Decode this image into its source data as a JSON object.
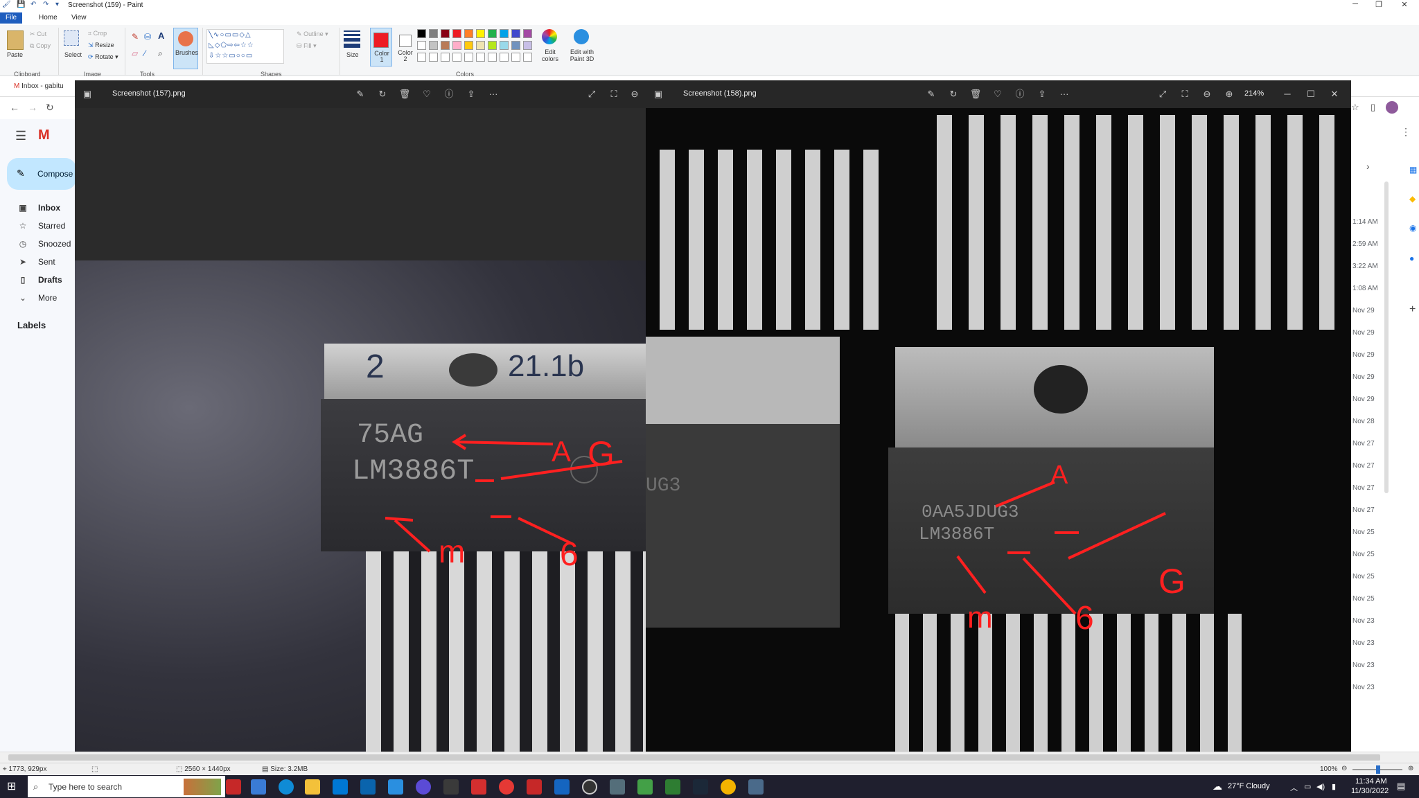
{
  "app": {
    "title": "Screenshot (159) - Paint"
  },
  "menu": {
    "tabs": [
      "File",
      "Home",
      "View"
    ]
  },
  "ribbon": {
    "clipboard": {
      "paste": "Paste",
      "cut": "Cut",
      "copy": "Copy",
      "group": "Clipboard"
    },
    "image": {
      "select": "Select",
      "crop": "Crop",
      "resize": "Resize",
      "rotate": "Rotate",
      "group": "Image"
    },
    "tools": {
      "text_icon": "A",
      "group": "Tools"
    },
    "brushes": "Brushes",
    "shapes": {
      "outline": "Outline",
      "fill": "Fill",
      "group": "Shapes"
    },
    "size": "Size",
    "color1": "Color 1",
    "color2": "Color 2",
    "colors_group": "Colors",
    "edit_colors": "Edit colors",
    "edit_paint3d": "Edit with Paint 3D",
    "palette_row1": [
      "#000000",
      "#7f7f7f",
      "#880015",
      "#ed1c24",
      "#ff7f27",
      "#fff200",
      "#22b14c",
      "#00a2e8",
      "#3f48cc",
      "#a349a4"
    ],
    "palette_row2": [
      "#ffffff",
      "#c3c3c3",
      "#b97a57",
      "#ffaec9",
      "#ffc90e",
      "#efe4b0",
      "#b5e61d",
      "#99d9ea",
      "#7092be",
      "#c8bfe7"
    ]
  },
  "gmail": {
    "tab": "Inbox - gabitu",
    "compose": "Compose",
    "items": [
      {
        "icon": "inbox-icon",
        "glyph": "▣",
        "label": "Inbox"
      },
      {
        "icon": "star-icon",
        "glyph": "☆",
        "label": "Starred"
      },
      {
        "icon": "clock-icon",
        "glyph": "◷",
        "label": "Snoozed"
      },
      {
        "icon": "send-icon",
        "glyph": "➤",
        "label": "Sent"
      },
      {
        "icon": "draft-icon",
        "glyph": "▯",
        "label": "Drafts"
      },
      {
        "icon": "chevron-down-icon",
        "glyph": "⌄",
        "label": "More"
      }
    ],
    "labels": "Labels",
    "dates": [
      "1:14 AM",
      "2:59 AM",
      "3:22 AM",
      "1:08 AM",
      "Nov 29",
      "Nov 29",
      "Nov 29",
      "Nov 29",
      "Nov 29",
      "Nov 28",
      "Nov 27",
      "Nov 27",
      "Nov 27",
      "Nov 27",
      "Nov 25",
      "Nov 25",
      "Nov 25",
      "Nov 25",
      "Nov 23",
      "Nov 23",
      "Nov 23",
      "Nov 23"
    ]
  },
  "viewer_left": {
    "filename": "Screenshot (157).png",
    "chip_text1": "75AG",
    "chip_text2": "LM3886T",
    "chip_num1": "2",
    "chip_num2": "21.1b",
    "ann_a": "A",
    "ann_g": "G",
    "ann_m": "m",
    "ann_6": "6"
  },
  "viewer_right": {
    "filename": "Screenshot (158).png",
    "zoom": "214%",
    "chip_text1": "0AA5JDUG3",
    "chip_text2": "LM3886T",
    "chip_side": "UG3",
    "ann_a": "A",
    "ann_g": "G",
    "ann_m": "m",
    "ann_6": "6"
  },
  "status": {
    "cursor": "1773, 929px",
    "dimensions": "2560 × 1440px",
    "size": "Size: 3.2MB",
    "zoom": "100%"
  },
  "taskbar": {
    "search": "Type here to search",
    "weather": "27°F  Cloudy",
    "time": "11:34 AM",
    "date": "11/30/2022"
  }
}
